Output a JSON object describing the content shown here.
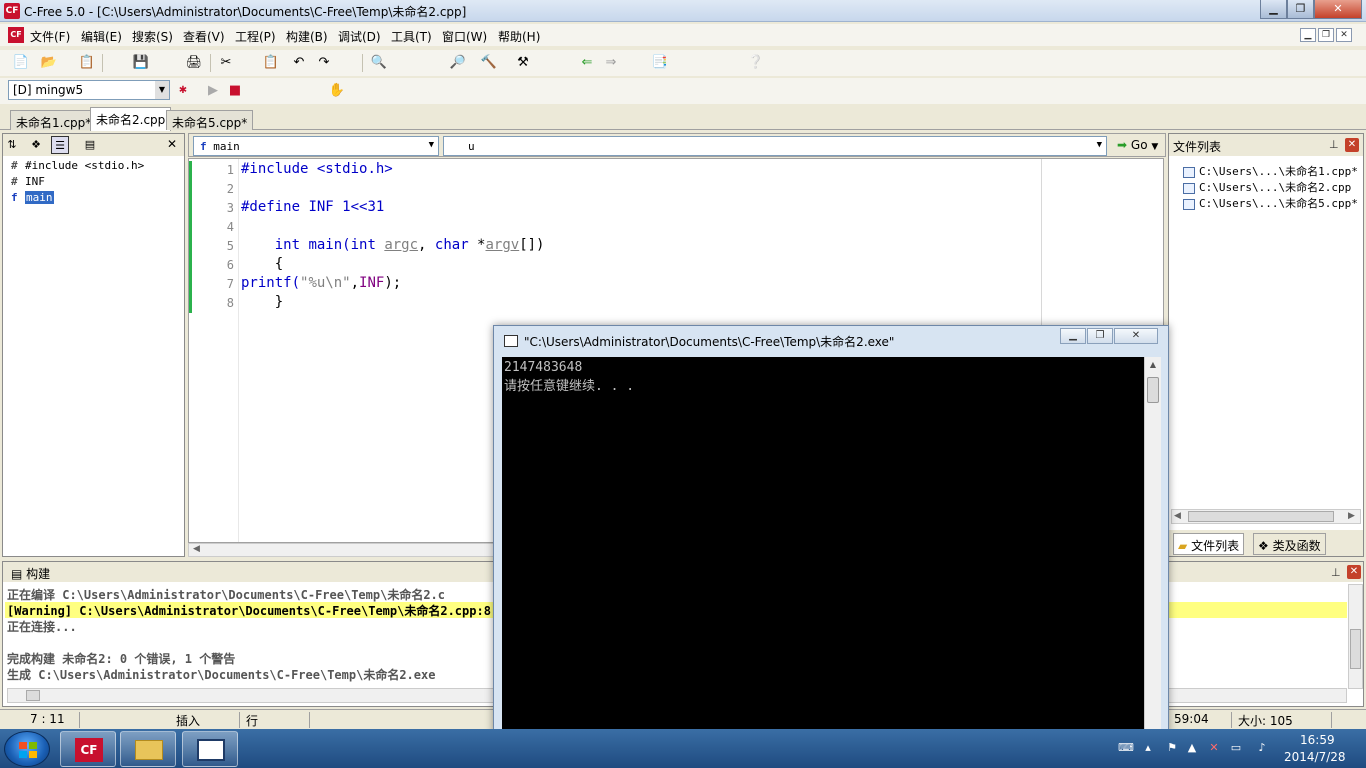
{
  "window": {
    "title": "C-Free 5.0 - [C:\\Users\\Administrator\\Documents\\C-Free\\Temp\\未命名2.cpp]",
    "app_icon_text": "CF",
    "min": "▁",
    "max": "❐",
    "close": "✕"
  },
  "menu": {
    "items": [
      "文件(F)",
      "编辑(E)",
      "搜索(S)",
      "查看(V)",
      "工程(P)",
      "构建(B)",
      "调试(D)",
      "工具(T)",
      "窗口(W)",
      "帮助(H)"
    ],
    "mdi": [
      "▁",
      "❐",
      "✕"
    ]
  },
  "toolbar": {
    "compiler": "[D] mingw5",
    "icons": [
      "📄",
      "📂",
      "📋",
      "💾",
      "🖨",
      "✂",
      "📋",
      "↶",
      "↷",
      "🔍",
      "🔎",
      "🔨",
      "⚒",
      "⇐",
      "⇒",
      "📑",
      "❔"
    ]
  },
  "tabs": [
    "未命名1.cpp*",
    "未命名2.cpp",
    "未命名5.cpp*"
  ],
  "left_panel": {
    "tree": [
      {
        "glyph": "#",
        "label": "#include <stdio.h>"
      },
      {
        "glyph": "#",
        "label": "INF"
      },
      {
        "glyph": "f",
        "label": "main"
      }
    ]
  },
  "editor": {
    "func_select": "main",
    "scope_select": "u",
    "go_label": "Go",
    "line_numbers": [
      "1",
      "2",
      "3",
      "4",
      "5",
      "6",
      "7",
      "8"
    ],
    "lines": {
      "l1_kw": "#include",
      "l1_rest": " <stdio.h>",
      "l3_kw": "#define",
      "l3_rest": " INF 1<<31",
      "l5_indent": "    ",
      "l5_int": "int",
      "l5_main": " main(",
      "l5_int2": "int",
      "l5_sp": " ",
      "l5_argc": "argc",
      "l5_comma": ", ",
      "l5_char": "char",
      "l5_star": " *",
      "l5_argv": "argv",
      "l5_end": "[])",
      "l6": "    {",
      "l7_fn": "printf(",
      "l7_str": "\"%u\\n\"",
      "l7_comma": ",",
      "l7_inf": "INF",
      "l7_end": ");",
      "l8": "    }"
    }
  },
  "right_panel": {
    "title": "文件列表",
    "files": [
      "C:\\Users\\...\\未命名1.cpp*",
      "C:\\Users\\...\\未命名2.cpp",
      "C:\\Users\\...\\未命名5.cpp*"
    ],
    "tabs": [
      "文件列表",
      "类及函数"
    ]
  },
  "build": {
    "title": "构建",
    "lines": [
      "正在编译 C:\\Users\\Administrator\\Documents\\C-Free\\Temp\\未命名2.c",
      "[Warning] C:\\Users\\Administrator\\Documents\\C-Free\\Temp\\未命名2.cpp:8:3",
      "正在连接...",
      "",
      "完成构建 未命名2: 0 个错误, 1 个警告",
      "生成 C:\\Users\\Administrator\\Documents\\C-Free\\Temp\\未命名2.exe"
    ]
  },
  "status": {
    "position": "7 : 11",
    "mode": "插入",
    "line_label": "行",
    "time_partial": "59:04",
    "size": "大小: 105"
  },
  "console": {
    "title": "\"C:\\Users\\Administrator\\Documents\\C-Free\\Temp\\未命名2.exe\"",
    "output": [
      "2147483648",
      "请按任意键继续. . ."
    ]
  },
  "taskbar": {
    "time": "16:59",
    "date": "2014/7/28"
  }
}
